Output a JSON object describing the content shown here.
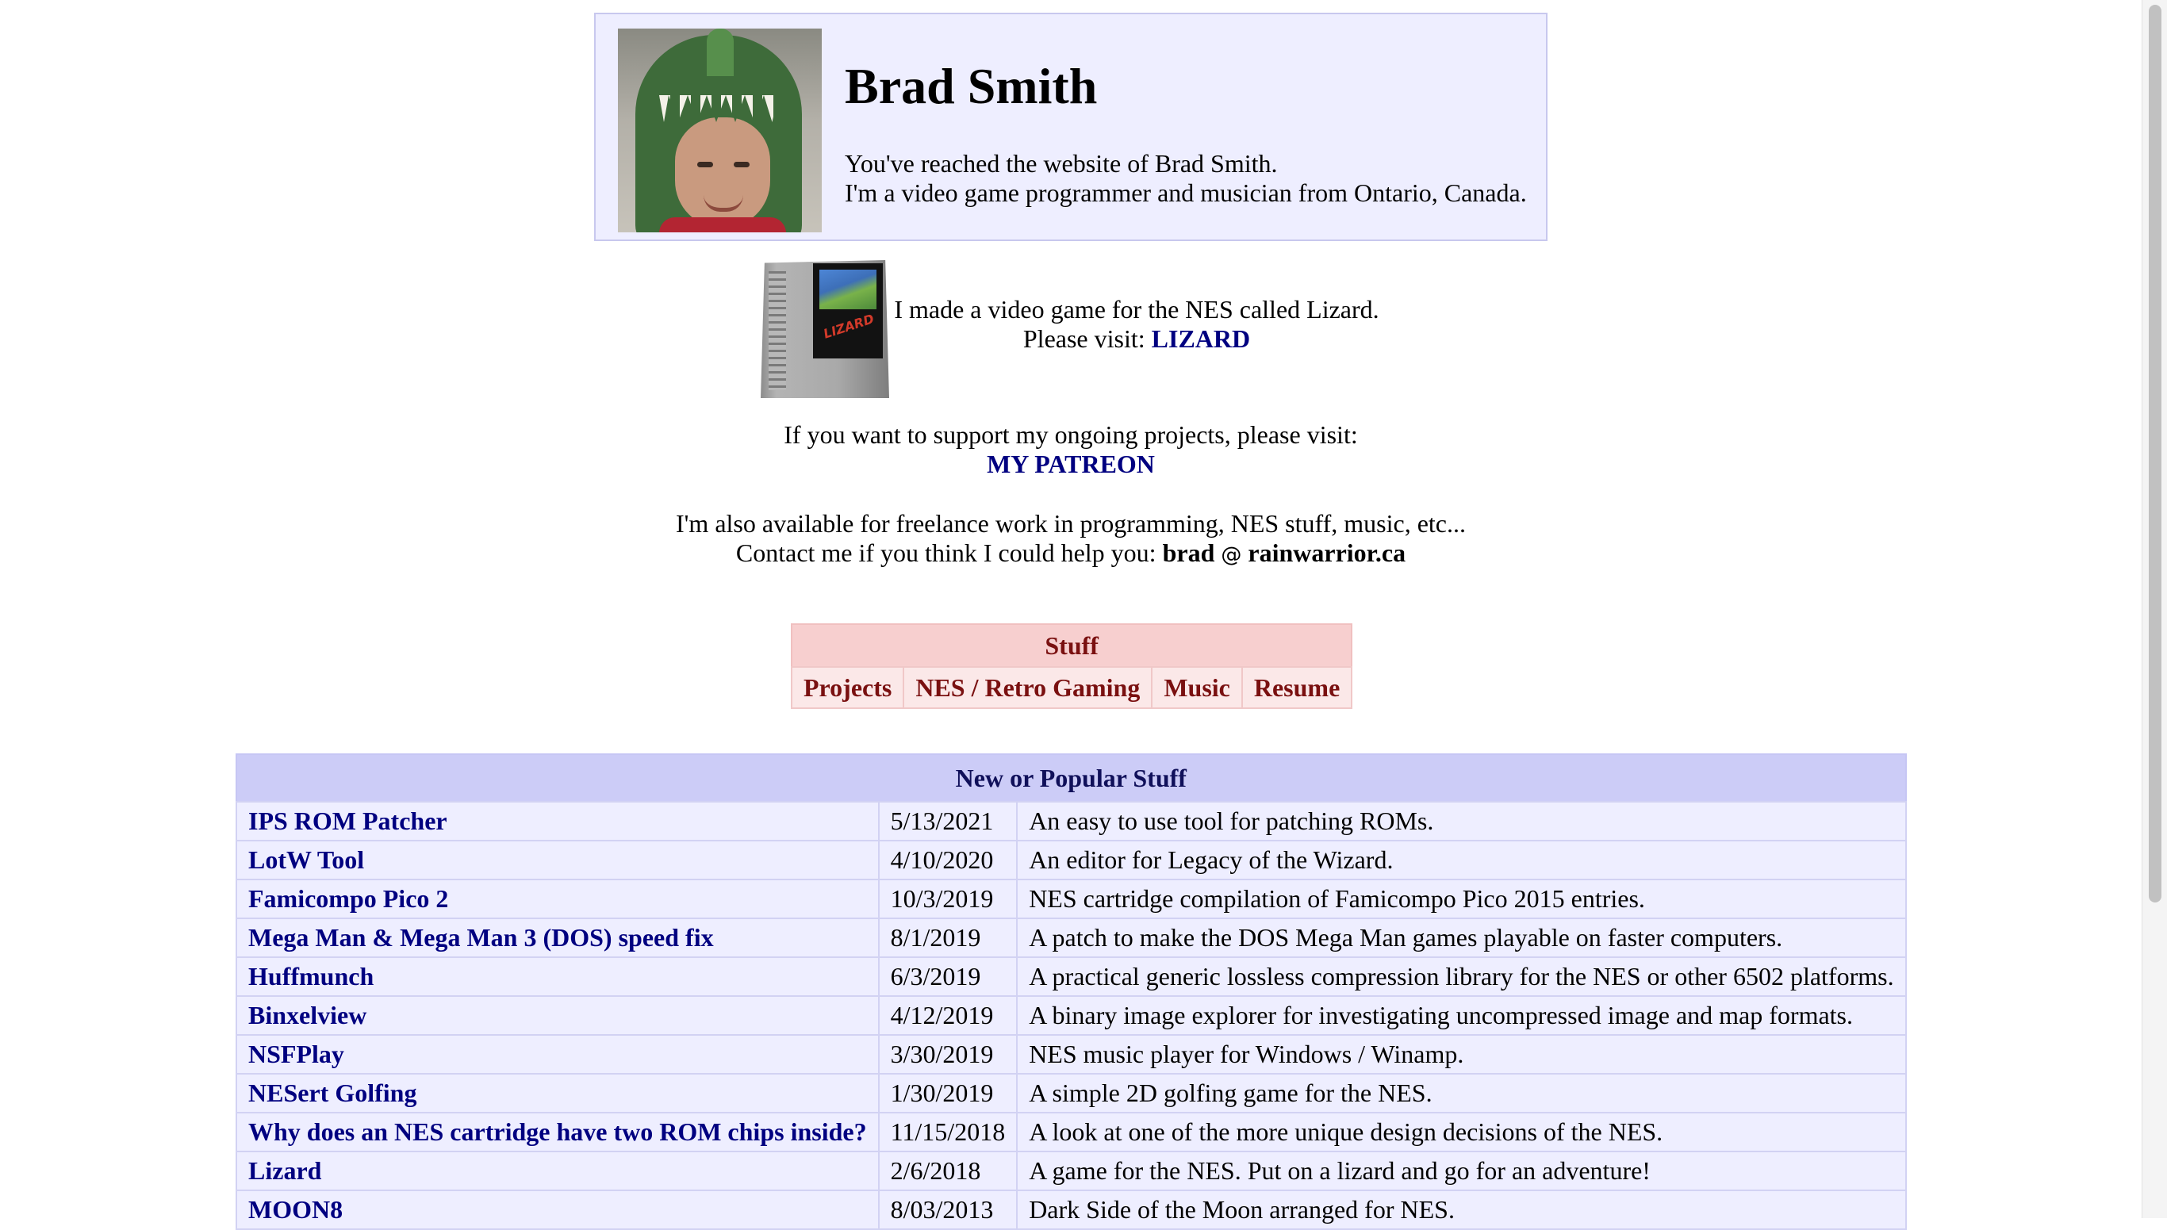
{
  "header": {
    "name": "Brad Smith",
    "intro_line1": "You've reached the website of Brad Smith.",
    "intro_line2": "I'm a video game programmer and musician from Ontario, Canada."
  },
  "lizard": {
    "cart_label": "LIZARD",
    "text_line1": "I made a video game for the NES called Lizard.",
    "visit_prefix": "Please visit:",
    "link": "LIZARD"
  },
  "support": {
    "text": "If you want to support my ongoing projects, please visit:",
    "link": "MY PATREON"
  },
  "freelance": {
    "text_line1": "I'm also available for freelance work in programming, NES stuff, music, etc...",
    "contact_prefix": "Contact me if you think I could help you:",
    "email_user": "brad",
    "email_at": "@",
    "email_domain": "rainwarrior.ca"
  },
  "stuff": {
    "title": "Stuff",
    "items": [
      "Projects",
      "NES / Retro Gaming",
      "Music",
      "Resume"
    ]
  },
  "popular": {
    "title": "New or Popular Stuff",
    "rows": [
      {
        "name": "IPS ROM Patcher",
        "date": "5/13/2021",
        "desc": "An easy to use tool for patching ROMs."
      },
      {
        "name": "LotW Tool",
        "date": "4/10/2020",
        "desc": "An editor for Legacy of the Wizard."
      },
      {
        "name": "Famicompo Pico 2",
        "date": "10/3/2019",
        "desc": "NES cartridge compilation of Famicompo Pico 2015 entries."
      },
      {
        "name": "Mega Man & Mega Man 3 (DOS) speed fix",
        "date": "8/1/2019",
        "desc": "A patch to make the DOS Mega Man games playable on faster computers."
      },
      {
        "name": "Huffmunch",
        "date": "6/3/2019",
        "desc": "A practical generic lossless compression library for the NES or other 6502 platforms."
      },
      {
        "name": "Binxelview",
        "date": "4/12/2019",
        "desc": "A binary image explorer for investigating uncompressed image and map formats."
      },
      {
        "name": "NSFPlay",
        "date": "3/30/2019",
        "desc": "NES music player for Windows / Winamp."
      },
      {
        "name": "NESert Golfing",
        "date": "1/30/2019",
        "desc": "A simple 2D golfing game for the NES."
      },
      {
        "name": "Why does an NES cartridge have two ROM chips inside?",
        "date": "11/15/2018",
        "desc": "A look at one of the more unique design decisions of the NES."
      },
      {
        "name": "Lizard",
        "date": "2/6/2018",
        "desc": "A game for the NES. Put on a lizard and go for an adventure!"
      },
      {
        "name": "MOON8",
        "date": "8/03/2013",
        "desc": "Dark Side of the Moon arranged for NES."
      }
    ]
  }
}
